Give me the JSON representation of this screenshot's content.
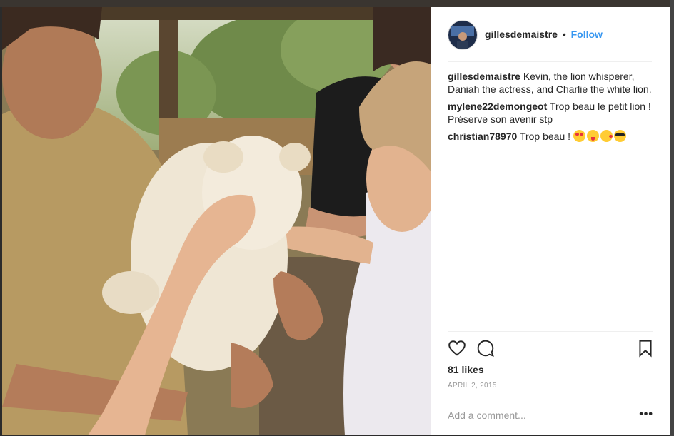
{
  "post": {
    "username": "gillesdemaistre",
    "separator": "•",
    "follow_label": "Follow",
    "caption": {
      "author": "gillesdemaistre",
      "text": "Kevin, the lion whisperer, Daniah the actress, and Charlie the white lion."
    },
    "comments": [
      {
        "author": "mylene22demongeot",
        "text": "Trop beau le petit lion ! Préserve son avenir stp"
      },
      {
        "author": "christian78970",
        "text": "Trop beau !"
      }
    ],
    "comment_emojis": [
      "heart-eyes-emoji",
      "tongue-wink-emoji",
      "kiss-emoji",
      "sunglasses-emoji"
    ],
    "likes": "81 likes",
    "date": "APRIL 2, 2015",
    "comment_placeholder": "Add a comment...",
    "more_label": "•••"
  },
  "icons": {
    "like": "heart-icon",
    "comment": "speech-bubble-icon",
    "save": "bookmark-icon",
    "more": "more-options-icon"
  },
  "colors": {
    "follow": "#3897f0",
    "text": "#262626",
    "muted": "#999999",
    "divider": "#efefef"
  }
}
